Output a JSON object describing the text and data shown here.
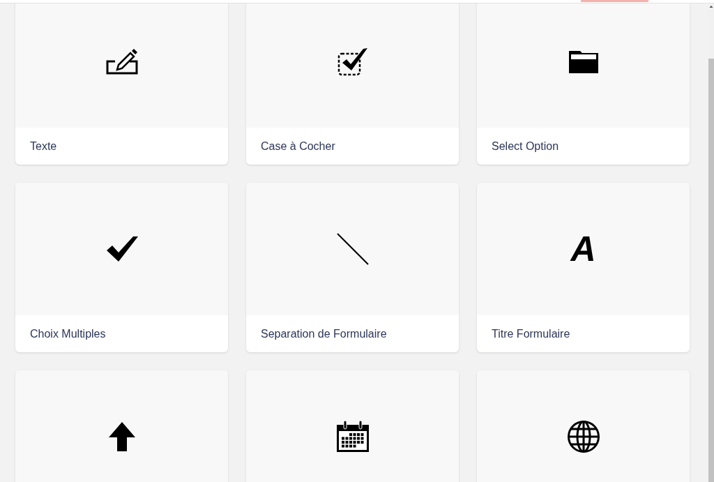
{
  "tiles": [
    {
      "kind": "icon",
      "label": "Texte"
    },
    {
      "kind": "icon",
      "label": "Case à Cocher"
    },
    {
      "kind": "icon",
      "label": "Select Option"
    },
    {
      "kind": "icon",
      "label": "Choix Multiples"
    },
    {
      "kind": "icon",
      "label": "Separation de Formulaire"
    },
    {
      "kind": "letter",
      "glyph": "A",
      "label": "Titre Formulaire"
    },
    {
      "kind": "icon"
    },
    {
      "kind": "icon"
    },
    {
      "kind": "icon"
    }
  ]
}
